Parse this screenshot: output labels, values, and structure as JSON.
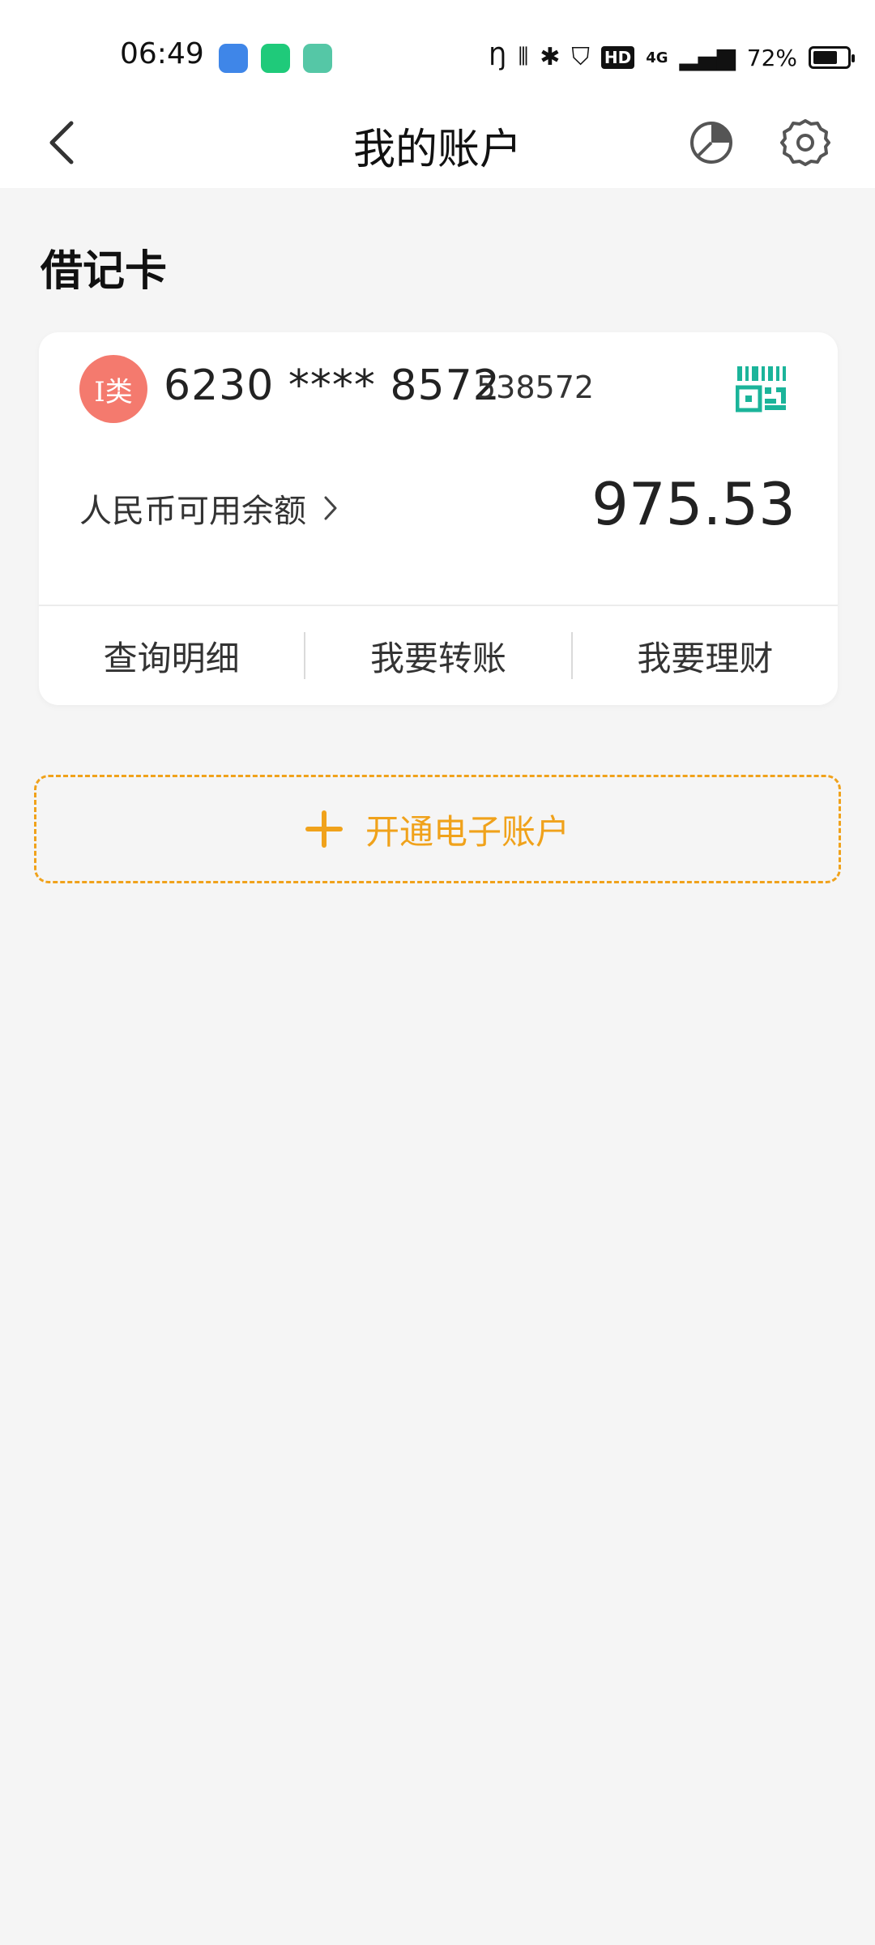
{
  "status_bar": {
    "time": "06:49",
    "app_icons": [
      {
        "name": "app-icon-blue",
        "color": "#3f86e8"
      },
      {
        "name": "app-icon-green",
        "color": "#1fca7a"
      },
      {
        "name": "app-icon-teal",
        "color": "#55c7a6"
      }
    ],
    "battery_percent": "72%",
    "battery_level": 0.72,
    "network": "4G"
  },
  "header": {
    "title": "我的账户"
  },
  "section": {
    "title": "借记卡"
  },
  "card": {
    "badge": "I类",
    "number": "6230 **** 8572",
    "sub_number": "538572",
    "balance_label": "人民币可用余额",
    "balance_amount": "975.53",
    "actions": [
      "查询明细",
      "我要转账",
      "我要理财"
    ]
  },
  "open_account": {
    "label": "开通电子账户"
  },
  "colors": {
    "accent": "#f0a21b",
    "badge": "#f47a6e",
    "qr": "#1bb49a",
    "background": "#f5f5f5"
  }
}
